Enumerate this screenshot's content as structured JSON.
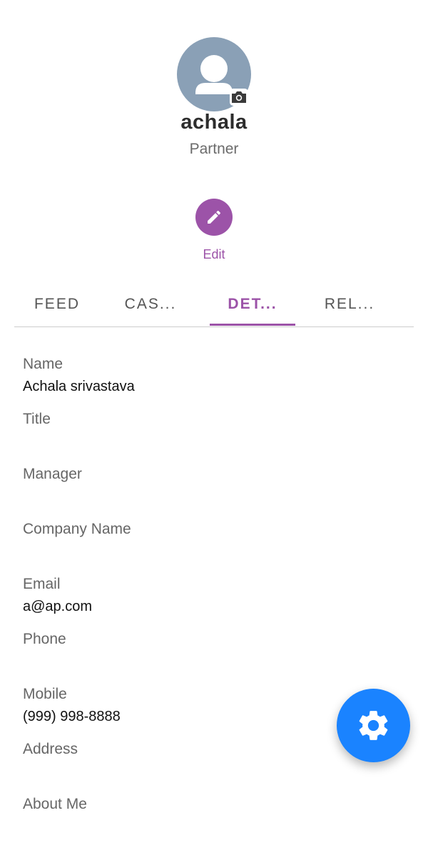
{
  "profile": {
    "username": "achala",
    "role": "Partner"
  },
  "actions": {
    "edit_label": "Edit"
  },
  "tabs": [
    {
      "label": "FEED",
      "active": false
    },
    {
      "label": "CAS...",
      "active": false
    },
    {
      "label": "DET...",
      "active": true
    },
    {
      "label": "REL...",
      "active": false
    }
  ],
  "details": {
    "name": {
      "label": "Name",
      "value": "Achala srivastava"
    },
    "title": {
      "label": "Title",
      "value": ""
    },
    "manager": {
      "label": "Manager",
      "value": ""
    },
    "company": {
      "label": "Company Name",
      "value": ""
    },
    "email": {
      "label": "Email",
      "value": "a@ap.com"
    },
    "phone": {
      "label": "Phone",
      "value": ""
    },
    "mobile": {
      "label": "Mobile",
      "value": "(999) 998-8888"
    },
    "address": {
      "label": "Address",
      "value": ""
    },
    "about": {
      "label": "About Me",
      "value": ""
    }
  },
  "colors": {
    "accent": "#9c53a8",
    "fab": "#1a83ff",
    "avatar_bg": "#8aa0b6"
  },
  "icons": {
    "avatar": "person-icon",
    "camera": "camera-icon",
    "edit": "pencil-icon",
    "fab": "gear-icon"
  }
}
